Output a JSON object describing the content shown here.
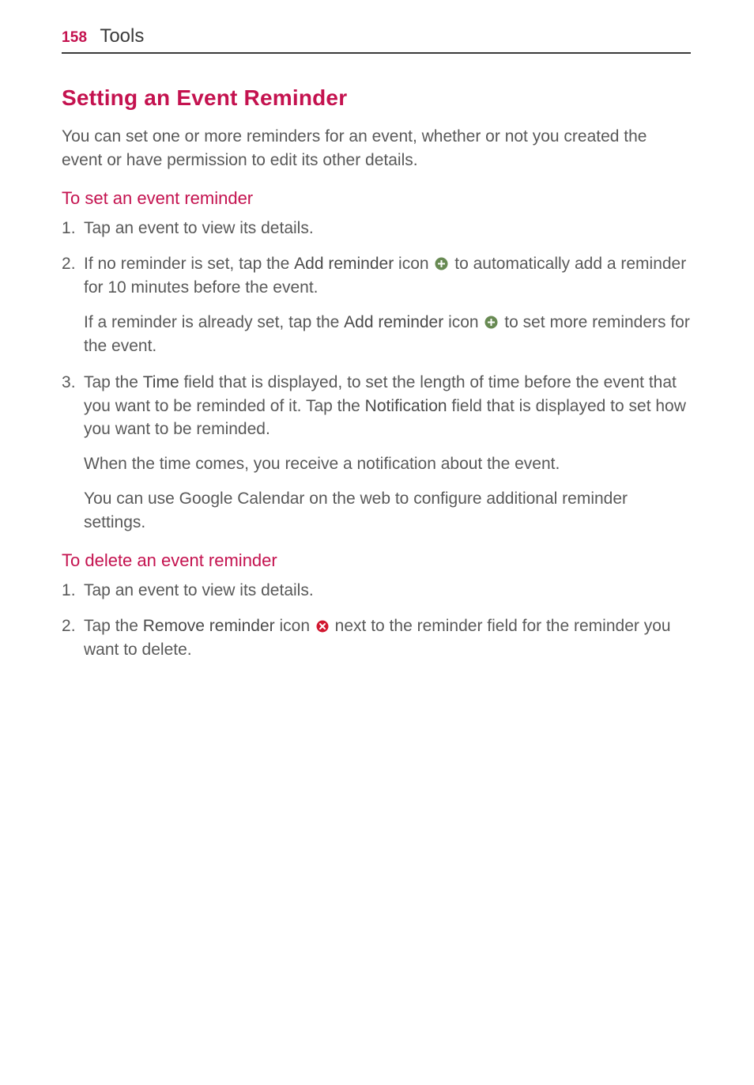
{
  "header": {
    "page_number": "158",
    "section": "Tools"
  },
  "title": "Setting an Event Reminder",
  "intro": "You can set one or more reminders for an event, whether or not you created the event or have permission to edit its other details.",
  "set": {
    "heading": "To set an event reminder",
    "s1": "Tap an event to view its details.",
    "s2_a": "If no reminder is set, tap the ",
    "s2_bold1": "Add reminder",
    "s2_b": " icon ",
    "s2_c": " to automatically add a reminder for 10 minutes before the event.",
    "s2_sub_a": "If a reminder is already set, tap the ",
    "s2_sub_bold": "Add reminder",
    "s2_sub_b": " icon ",
    "s2_sub_c": " to set more reminders for the event.",
    "s3_a": "Tap the ",
    "s3_bold1": "Time",
    "s3_b": " field that is displayed, to set the length of time before the event that you want to be reminded of it. Tap the ",
    "s3_bold2": "Notification",
    "s3_c": " field that is displayed to set how you want to be reminded.",
    "s3_sub1": "When the time comes, you receive a notification about the event.",
    "s3_sub2": "You can use Google Calendar on the web to configure additional reminder settings."
  },
  "del": {
    "heading": "To delete an event reminder",
    "s1": "Tap an event to view its details.",
    "s2_a": "Tap the ",
    "s2_bold": "Remove reminder",
    "s2_b": " icon ",
    "s2_c": " next to the reminder field for the reminder you want to delete."
  },
  "icons": {
    "add": "add-reminder-icon",
    "remove": "remove-reminder-icon"
  }
}
